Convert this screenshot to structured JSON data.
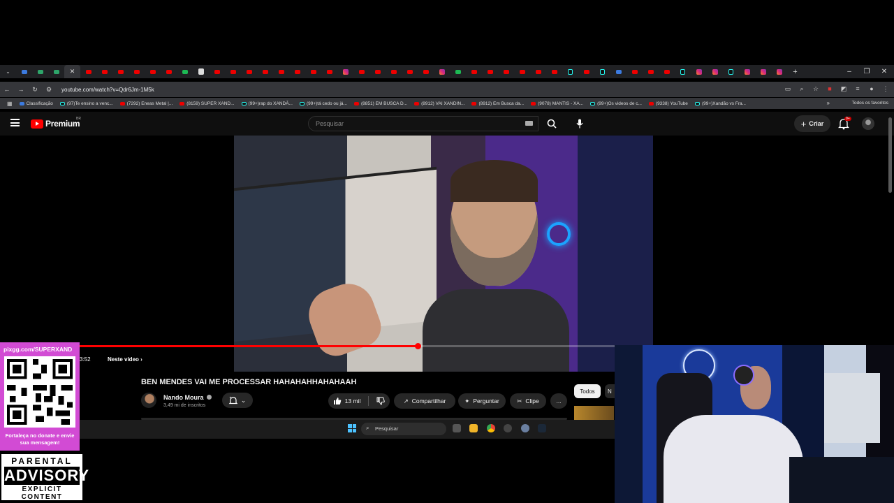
{
  "browser": {
    "url": "youtube.com/watch?v=Qdr6Jm-1M5k",
    "tab_icons": [
      "yt",
      "yt",
      "yt",
      "yt",
      "yt",
      "yt",
      "green",
      "white",
      "yt",
      "yt",
      "yt",
      "yt",
      "yt",
      "yt",
      "yt",
      "yt",
      "ig",
      "yt",
      "yt",
      "yt",
      "yt",
      "yt",
      "ig",
      "green",
      "yt",
      "yt",
      "yt",
      "yt",
      "yt",
      "yt",
      "tk",
      "yt",
      "tk",
      "other",
      "yt",
      "yt",
      "yt",
      "tk",
      "ig",
      "ig",
      "tk",
      "ig",
      "ig",
      "ig"
    ],
    "bookmarks": [
      {
        "icon": "blue",
        "label": "Classificação"
      },
      {
        "icon": "tk",
        "label": "(97)Te ensino a venc..."
      },
      {
        "icon": "yt",
        "label": "(7292) Eneas Metal |..."
      },
      {
        "icon": "yt",
        "label": "(8159) SUPER XAND..."
      },
      {
        "icon": "tk",
        "label": "(99+)rap do XANDÃ..."
      },
      {
        "icon": "tk",
        "label": "(99+)tá cedo ou já..."
      },
      {
        "icon": "yt",
        "label": "(8851) EM BUSCA D..."
      },
      {
        "icon": "yt",
        "label": "(8912) VAI XANDIN..."
      },
      {
        "icon": "yt",
        "label": "(8912) Em Busca da..."
      },
      {
        "icon": "yt",
        "label": "(9078) MANTIS - XA..."
      },
      {
        "icon": "tk",
        "label": "(99+)Os videos de c..."
      },
      {
        "icon": "yt",
        "label": "(9338) YouTube"
      },
      {
        "icon": "tk",
        "label": "(99+)Xandão vs Fra..."
      }
    ],
    "all_bookmarks_label": "Todos os favoritos"
  },
  "youtube": {
    "logo_text": "Premium",
    "country_code": "BR",
    "search_placeholder": "Pesquisar",
    "create_label": "Criar",
    "notification_badge": "9+",
    "player": {
      "progress_fraction": 0.59,
      "time_display": "3:52",
      "chapter_label": "Neste vídeo"
    },
    "video": {
      "title": "BEN MENDES VAI ME PROCESSAR HAHAHAHHAHAHAAH",
      "channel_name": "Nando Moura",
      "subscribers": "3,49 mi de inscritos",
      "likes": "13 mil",
      "share_label": "Compartilhar",
      "ask_label": "Perguntar",
      "clip_label": "Clipe",
      "more_label": "..."
    },
    "chips": {
      "all_label": "Todos",
      "next_label": "N"
    }
  },
  "taskbar": {
    "search_placeholder": "Pesquisar"
  },
  "overlay": {
    "pix_url": "pixgg.com/SUPERXAND",
    "donate_text": "Fortaleça no donate e envie sua mensagem!",
    "advisory_top": "PARENTAL",
    "advisory_mid": "ADVISORY",
    "advisory_bottom": "EXPLICIT CONTENT"
  },
  "colors": {
    "youtube_red": "#ff0000",
    "pix_panel": "#d24bd4",
    "page_bg": "#0f0f0f"
  }
}
